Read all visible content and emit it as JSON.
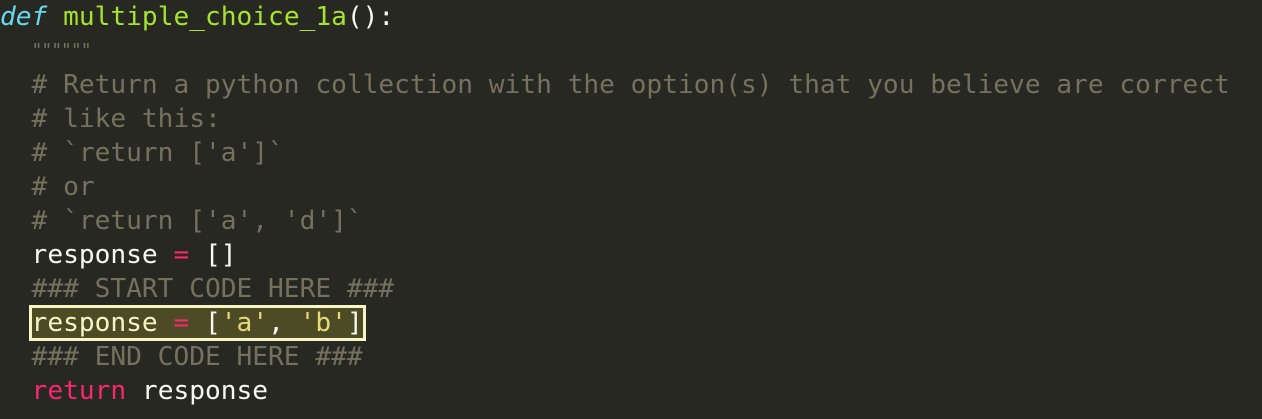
{
  "editor": {
    "theme_colors": {
      "background": "#272822",
      "keyword": "#66d9ef",
      "function": "#a6e22e",
      "comment": "#75715e",
      "operator": "#f92672",
      "string": "#e6db74",
      "text": "#f8f8f2",
      "highlight_border": "#f8f5c4",
      "highlight_fill": "#4d4a26"
    },
    "highlighted_line": 9,
    "lines": [
      [
        {
          "c": "kw-def",
          "v": "def"
        },
        {
          "c": "punc",
          "v": " "
        },
        {
          "c": "fn",
          "v": "multiple_choice_1a"
        },
        {
          "c": "punc",
          "v": "():"
        }
      ],
      [
        {
          "c": "punc",
          "v": "  "
        },
        {
          "c": "cmt",
          "v": "\"\"\"\"\"\""
        }
      ],
      [
        {
          "c": "punc",
          "v": "  "
        },
        {
          "c": "cmt",
          "v": "# Return a python collection with the option(s) that you believe are correct"
        }
      ],
      [
        {
          "c": "punc",
          "v": "  "
        },
        {
          "c": "cmt",
          "v": "# like this:"
        }
      ],
      [
        {
          "c": "punc",
          "v": "  "
        },
        {
          "c": "cmt",
          "v": "# `return ['a']`"
        }
      ],
      [
        {
          "c": "punc",
          "v": "  "
        },
        {
          "c": "cmt",
          "v": "# or"
        }
      ],
      [
        {
          "c": "punc",
          "v": "  "
        },
        {
          "c": "cmt",
          "v": "# `return ['a', 'd']`"
        }
      ],
      [
        {
          "c": "punc",
          "v": "  "
        },
        {
          "c": "id",
          "v": "response "
        },
        {
          "c": "op",
          "v": "="
        },
        {
          "c": "punc",
          "v": " []"
        }
      ],
      [
        {
          "c": "punc",
          "v": "  "
        },
        {
          "c": "cmt",
          "v": "### START CODE HERE ###"
        }
      ],
      [
        {
          "c": "punc",
          "v": "  "
        },
        {
          "c": "id",
          "v": "response ",
          "hl": true
        },
        {
          "c": "op",
          "v": "=",
          "hl": true
        },
        {
          "c": "punc",
          "v": " [",
          "hl": true
        },
        {
          "c": "str",
          "v": "'a'",
          "hl": true
        },
        {
          "c": "punc",
          "v": ", ",
          "hl": true
        },
        {
          "c": "str",
          "v": "'b'",
          "hl": true
        },
        {
          "c": "punc",
          "v": "]",
          "hl": true
        }
      ],
      [
        {
          "c": "punc",
          "v": "  "
        },
        {
          "c": "cmt",
          "v": "### END CODE HERE ###"
        }
      ],
      [
        {
          "c": "punc",
          "v": "  "
        },
        {
          "c": "kw",
          "v": "return"
        },
        {
          "c": "id",
          "v": " response"
        }
      ]
    ]
  }
}
